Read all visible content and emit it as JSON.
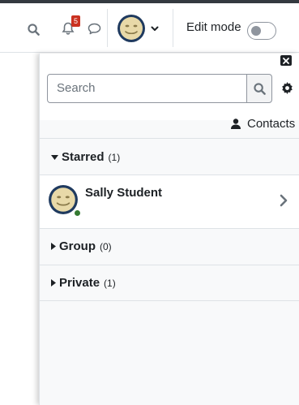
{
  "navbar": {
    "notification_count": "5",
    "edit_mode_label": "Edit mode",
    "edit_mode_on": false
  },
  "drawer": {
    "search_placeholder": "Search",
    "contacts_label": "Contacts",
    "sections": {
      "starred": {
        "label": "Starred",
        "count": "(1)"
      },
      "group": {
        "label": "Group",
        "count": "(0)"
      },
      "private": {
        "label": "Private",
        "count": "(1)"
      }
    },
    "starred_contact": {
      "name": "Sally Student",
      "status": "online"
    }
  },
  "colors": {
    "badge": "#ca3120",
    "online": "#357a32",
    "avatar_ring": "#1f3a5f",
    "avatar_face": "#e8d9a8"
  }
}
